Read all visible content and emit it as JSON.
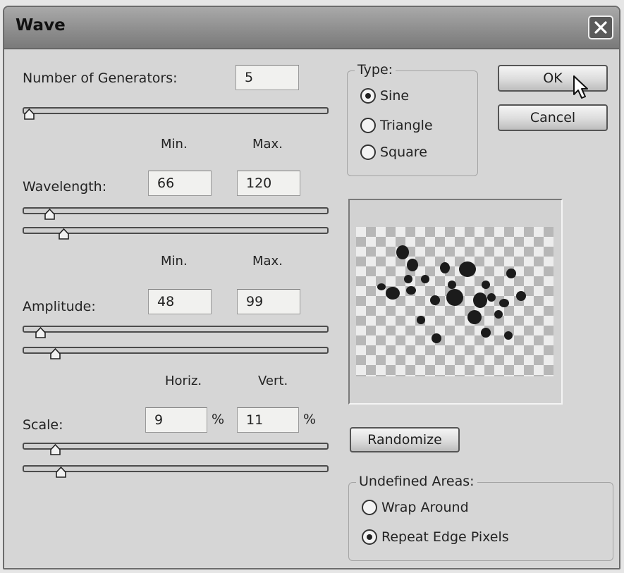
{
  "window": {
    "title": "Wave"
  },
  "generators": {
    "label": "Number of Generators:",
    "value": "5",
    "level": 0.0
  },
  "headers": {
    "min": "Min.",
    "max": "Max.",
    "horiz": "Horiz.",
    "vert": "Vert."
  },
  "wavelength": {
    "label": "Wavelength:",
    "min": "66",
    "max": "120",
    "min_level": 0.07,
    "max_level": 0.12
  },
  "amplitude": {
    "label": "Amplitude:",
    "min": "48",
    "max": "99",
    "min_level": 0.04,
    "max_level": 0.09
  },
  "scale": {
    "label": "Scale:",
    "horiz": "9",
    "vert": "11",
    "percent": "%",
    "horiz_level": 0.09,
    "vert_level": 0.11
  },
  "type": {
    "legend": "Type:",
    "options": [
      {
        "label": "Sine",
        "selected": true
      },
      {
        "label": "Triangle",
        "selected": false
      },
      {
        "label": "Square",
        "selected": false
      }
    ]
  },
  "buttons": {
    "ok": "OK",
    "cancel": "Cancel",
    "randomize": "Randomize"
  },
  "undefined_areas": {
    "legend": "Undefined Areas:",
    "options": [
      {
        "label": "Wrap Around",
        "selected": false
      },
      {
        "label": "Repeat Edge Pixels",
        "selected": true
      }
    ]
  },
  "icons": {
    "close": "close-icon",
    "cursor": "pointer-cursor-icon",
    "thumb": "slider-thumb-icon"
  }
}
